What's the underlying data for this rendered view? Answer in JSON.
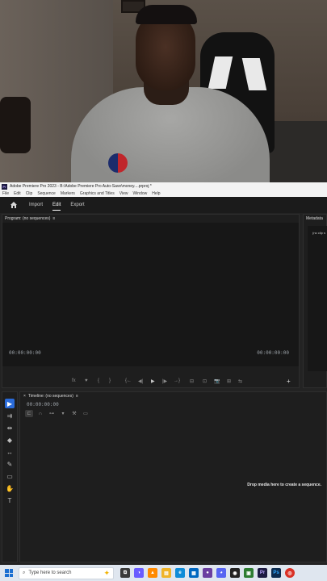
{
  "window": {
    "title": "Adobe Premiere Pro 2023 - B:\\Adobe Premiere Pro Auto-Save\\money....prproj *",
    "app_icon_label": "Pr"
  },
  "menu": [
    "File",
    "Edit",
    "Clip",
    "Sequence",
    "Markers",
    "Graphics and Titles",
    "View",
    "Window",
    "Help"
  ],
  "workspace_tabs": [
    {
      "label": "Import",
      "active": false
    },
    {
      "label": "Edit",
      "active": true
    },
    {
      "label": "Export",
      "active": false
    }
  ],
  "program_monitor": {
    "title": "Program: (no sequences)",
    "menu_glyph": "≡",
    "timecode_left": "00:00:00:00",
    "timecode_right": "00:00:00:00",
    "controls": [
      "fx",
      "♥",
      "{",
      "}",
      "{←",
      "◀|",
      "◀",
      "▶",
      "|▶",
      "→}",
      "⊟",
      "⊡",
      "📷",
      "⊞",
      "⇆",
      "+"
    ]
  },
  "metadata_panel": {
    "title": "Metadata",
    "empty_text": "(no clip s"
  },
  "tools": [
    {
      "name": "selection-tool",
      "glyph": "▶",
      "active": true
    },
    {
      "name": "track-select-tool",
      "glyph": "⇉",
      "active": false
    },
    {
      "name": "ripple-edit-tool",
      "glyph": "⇹",
      "active": false
    },
    {
      "name": "razor-tool",
      "glyph": "◆",
      "active": false
    },
    {
      "name": "slip-tool",
      "glyph": "↔",
      "active": false
    },
    {
      "name": "pen-tool",
      "glyph": "✎",
      "active": false
    },
    {
      "name": "rectangle-tool",
      "glyph": "▭",
      "active": false
    },
    {
      "name": "hand-tool",
      "glyph": "✋",
      "active": false
    },
    {
      "name": "type-tool",
      "glyph": "T",
      "active": false
    }
  ],
  "timeline": {
    "close_glyph": "×",
    "title": "Timeline: (no sequences)",
    "menu_glyph": "≡",
    "timecode": "00:00:00:00",
    "drop_message": "Drop media here to create a sequence."
  },
  "taskbar": {
    "search_placeholder": "Type here to search",
    "apps": [
      {
        "name": "task-view",
        "label": "⧉",
        "color": "#3a3a3a"
      },
      {
        "name": "copilot",
        "label": "◑",
        "color": "#6a5cff"
      },
      {
        "name": "vlc",
        "label": "▲",
        "color": "#ff8a00"
      },
      {
        "name": "file-explorer",
        "label": "▤",
        "color": "#f0b429"
      },
      {
        "name": "edge",
        "label": "e",
        "color": "#0f8cd8"
      },
      {
        "name": "store",
        "label": "▦",
        "color": "#0067c0"
      },
      {
        "name": "app-purple",
        "label": "●",
        "color": "#6b3fa0"
      },
      {
        "name": "discord",
        "label": "◕",
        "color": "#5865f2"
      },
      {
        "name": "obs",
        "label": "◉",
        "color": "#222222"
      },
      {
        "name": "greenshot",
        "label": "▣",
        "color": "#2e7d32"
      },
      {
        "name": "premiere",
        "label": "Pr",
        "color": "#1d1b42"
      },
      {
        "name": "photoshop",
        "label": "Ps",
        "color": "#0c2c50"
      },
      {
        "name": "chrome",
        "label": "◎",
        "color": "#d93025"
      }
    ]
  }
}
